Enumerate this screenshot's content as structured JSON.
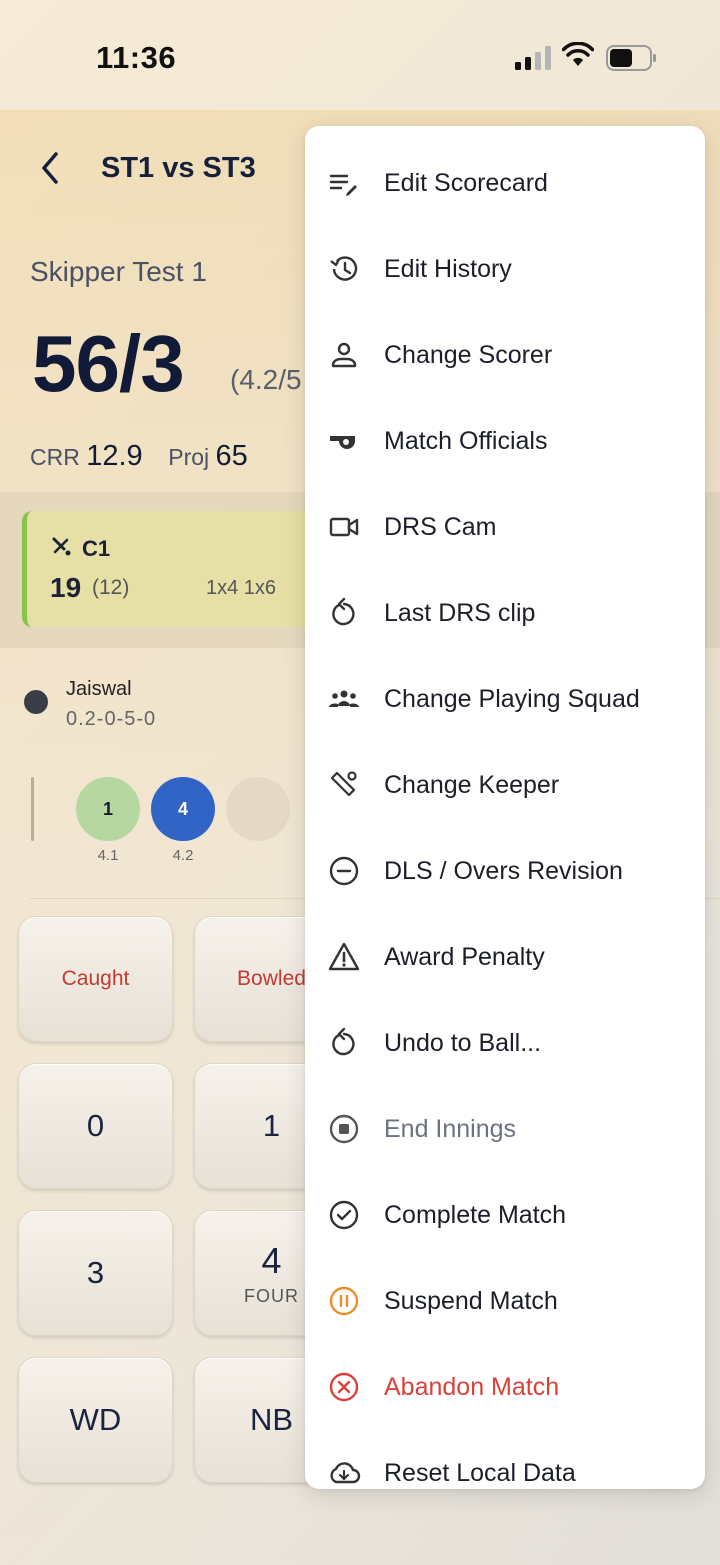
{
  "status_bar": {
    "time": "11:36"
  },
  "header": {
    "title": "ST1 vs ST3"
  },
  "innings": {
    "team": "Skipper Test 1",
    "score": "56/3",
    "overs": "(4.2/5",
    "crr_label": "CRR",
    "crr": "12.9",
    "proj_label": "Proj",
    "proj": "65"
  },
  "batter": {
    "name": "C1",
    "runs": "19",
    "balls": "(12)",
    "boundaries": "1x4 1x6",
    "accent": "#8bc34a"
  },
  "bowler": {
    "name": "Jaiswal",
    "figures": "0.2-0-5-0"
  },
  "recent_balls": [
    {
      "value": "1",
      "over": "4.1",
      "color": "#b6d7a0"
    },
    {
      "value": "4",
      "over": "4.2",
      "color": "#3164c4"
    }
  ],
  "keypad": {
    "caught": "Caught",
    "bowled": "Bowled",
    "zero": "0",
    "one": "1",
    "three": "3",
    "four": "4",
    "four_sub": "FOUR",
    "wd": "WD",
    "nb": "NB"
  },
  "menu": {
    "items": [
      {
        "label": "Edit Scorecard",
        "icon": "edit-list-icon"
      },
      {
        "label": "Edit History",
        "icon": "history-icon"
      },
      {
        "label": "Change Scorer",
        "icon": "person-icon"
      },
      {
        "label": "Match Officials",
        "icon": "whistle-icon"
      },
      {
        "label": "DRS Cam",
        "icon": "video-camera-icon"
      },
      {
        "label": "Last DRS clip",
        "icon": "replay-icon"
      },
      {
        "label": "Change Playing Squad",
        "icon": "group-icon"
      },
      {
        "label": "Change Keeper",
        "icon": "keeper-icon"
      },
      {
        "label": "DLS / Overs Revision",
        "icon": "minus-circle-icon"
      },
      {
        "label": "Award Penalty",
        "icon": "warning-icon"
      },
      {
        "label": "Undo to Ball...",
        "icon": "undo-icon"
      },
      {
        "label": "End Innings",
        "icon": "stop-circle-icon"
      },
      {
        "label": "Complete Match",
        "icon": "check-circle-icon"
      },
      {
        "label": "Suspend Match",
        "icon": "pause-circle-icon"
      },
      {
        "label": "Abandon Match",
        "icon": "cancel-circle-icon"
      },
      {
        "label": "Reset Local Data",
        "icon": "cloud-download-icon"
      }
    ],
    "colors": {
      "default": "#1c1f2a",
      "muted": "#6d7280",
      "warning": "#e8902a",
      "danger": "#d9423a"
    }
  }
}
